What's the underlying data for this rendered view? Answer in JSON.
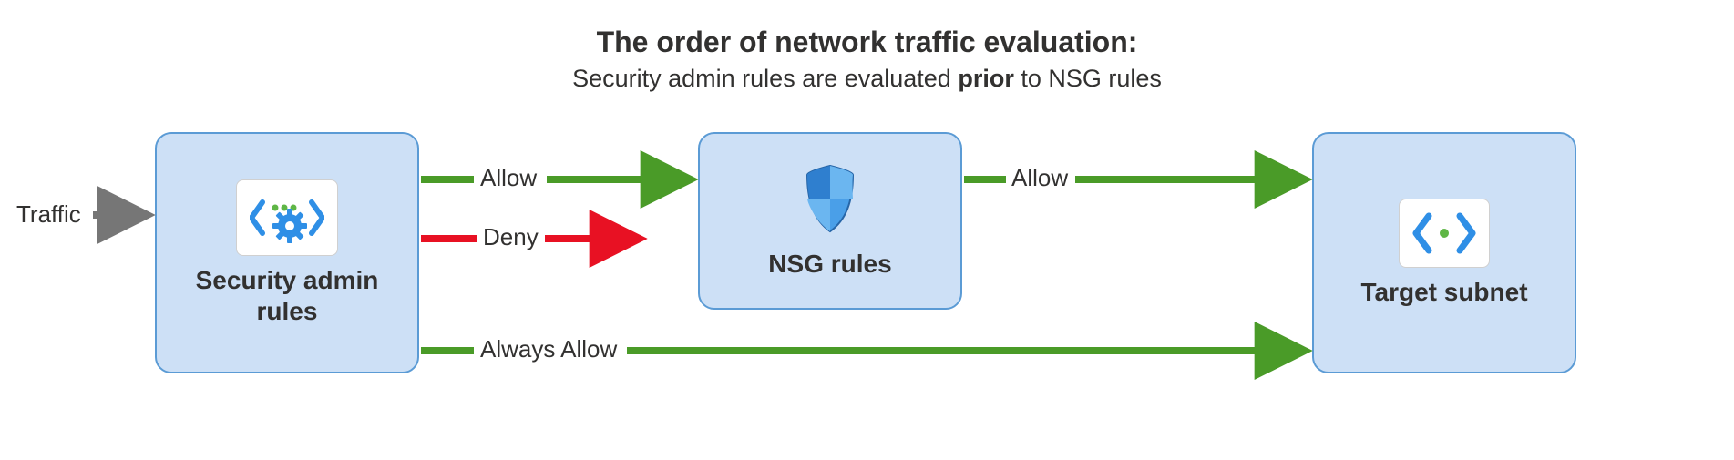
{
  "title": "The order of network traffic evaluation:",
  "subtitle_prefix": "Security admin rules are evaluated ",
  "subtitle_bold": "prior",
  "subtitle_suffix": " to NSG rules",
  "traffic_label": "Traffic",
  "nodes": {
    "security_admin": "Security admin rules",
    "nsg": "NSG rules",
    "target": "Target subnet"
  },
  "arrows": {
    "allow1": "Allow",
    "deny": "Deny",
    "allow2": "Allow",
    "always_allow": "Always Allow"
  },
  "colors": {
    "allow": "#4a9b28",
    "deny": "#e81123",
    "traffic": "#767676",
    "node_fill": "#cde0f6",
    "node_border": "#5b9bd5"
  }
}
